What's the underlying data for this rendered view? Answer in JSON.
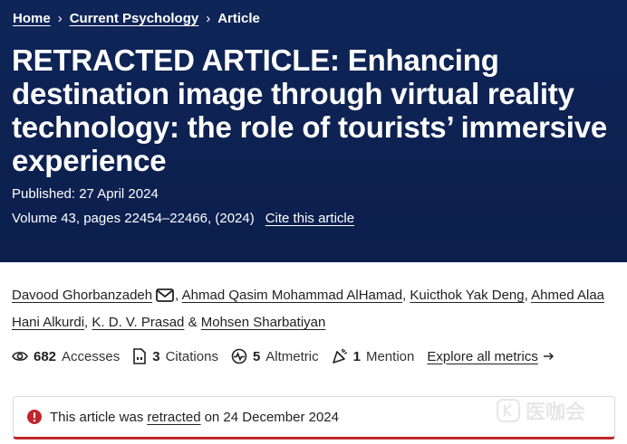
{
  "breadcrumb": {
    "home": "Home",
    "journal": "Current Psychology",
    "current": "Article"
  },
  "article": {
    "title": "RETRACTED ARTICLE: Enhancing destination image through virtual reality technology: the role of tourists’ immersive experience",
    "published": "Published: 27 April 2024",
    "volume": "Volume 43, pages 22454–22466, (2024)",
    "cite_link": "Cite this article"
  },
  "authors": [
    "Davood Ghorbanzadeh",
    "Ahmad Qasim Mohammad AlHamad",
    "Kuicthok Yak Deng",
    "Ahmed Alaa Hani Alkurdi",
    "K. D. V. Prasad",
    "Mohsen Sharbatiyan"
  ],
  "author_separators": {
    "comma": ",",
    "amp": "&"
  },
  "metrics": {
    "accesses": {
      "value": "682",
      "label": "Accesses"
    },
    "citations": {
      "value": "3",
      "label": "Citations"
    },
    "altmetric": {
      "value": "5",
      "label": "Altmetric"
    },
    "mention": {
      "value": "1",
      "label": "Mention"
    },
    "explore": "Explore all metrics"
  },
  "retraction": {
    "prefix": "This article was",
    "link": "retracted",
    "suffix": "on 24 December 2024"
  },
  "watermark": {
    "text": "医咖会"
  },
  "colors": {
    "hero_bg": "#0e2152",
    "retraction_accent": "#c0262d",
    "text": "#222222"
  }
}
